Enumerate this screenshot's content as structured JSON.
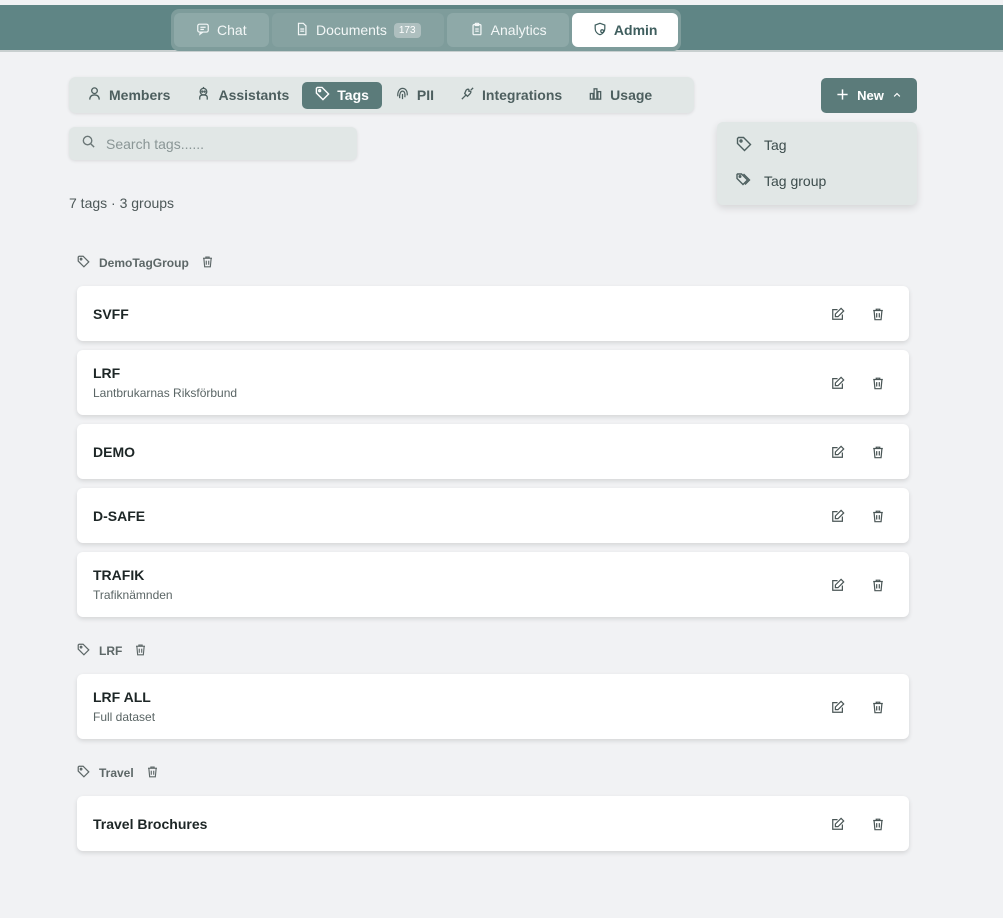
{
  "topnav": {
    "tabs": [
      {
        "label": "Chat",
        "icon": "chat-icon"
      },
      {
        "label": "Documents",
        "icon": "document-icon",
        "badge": "173"
      },
      {
        "label": "Analytics",
        "icon": "clipboard-icon"
      },
      {
        "label": "Admin",
        "icon": "shield-gear-icon",
        "active": true
      }
    ]
  },
  "subnav": {
    "tabs": [
      {
        "label": "Members",
        "icon": "user-icon"
      },
      {
        "label": "Assistants",
        "icon": "robot-icon"
      },
      {
        "label": "Tags",
        "icon": "tag-icon",
        "active": true
      },
      {
        "label": "PII",
        "icon": "fingerprint-icon"
      },
      {
        "label": "Integrations",
        "icon": "plug-icon"
      },
      {
        "label": "Usage",
        "icon": "bar-chart-icon"
      }
    ]
  },
  "new_button": {
    "label": "New"
  },
  "new_menu": {
    "items": [
      {
        "label": "Tag",
        "icon": "tag-icon"
      },
      {
        "label": "Tag group",
        "icon": "tags-icon"
      }
    ]
  },
  "search": {
    "placeholder": "Search tags......",
    "value": ""
  },
  "summary": "7 tags · 3 groups",
  "groups": [
    {
      "name": "DemoTagGroup",
      "tags": [
        {
          "name": "SVFF",
          "description": ""
        },
        {
          "name": "LRF",
          "description": "Lantbrukarnas Riksförbund"
        },
        {
          "name": "DEMO",
          "description": ""
        },
        {
          "name": "D-SAFE",
          "description": ""
        },
        {
          "name": "TRAFIK",
          "description": "Trafiknämnden"
        }
      ]
    },
    {
      "name": "LRF",
      "tags": [
        {
          "name": "LRF ALL",
          "description": "Full dataset"
        }
      ]
    },
    {
      "name": "Travel",
      "tags": [
        {
          "name": "Travel Brochures",
          "description": ""
        }
      ]
    }
  ],
  "colors": {
    "header": "#5f8585",
    "accent": "#5b7b7a",
    "page_bg": "#f1f2f4"
  }
}
